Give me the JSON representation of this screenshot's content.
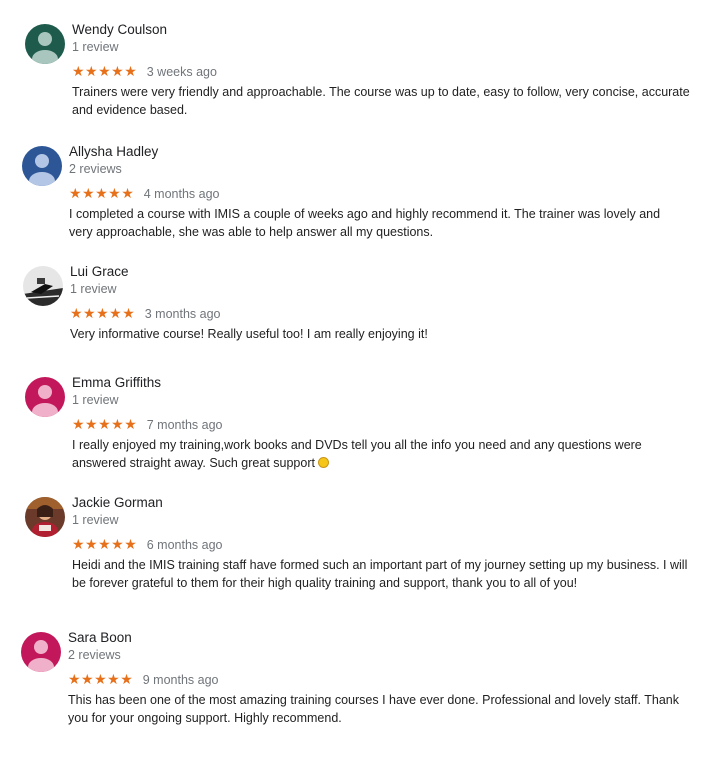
{
  "reviews": [
    {
      "name": "Wendy Coulson",
      "count": "1 review",
      "stars": "★★★★★",
      "time": "3 weeks ago",
      "text": "Trainers were very friendly and approachable.  The course was up to date, easy to follow, very concise, accurate and evidence based.",
      "avatar_color": "#1e5b4c"
    },
    {
      "name": "Allysha Hadley",
      "count": "2 reviews",
      "stars": "★★★★★",
      "time": "4 months ago",
      "text": "I completed a course with IMIS a couple of weeks ago and highly recommend it. The trainer was lovely and very approachable, she was able to help answer all my questions.",
      "avatar_color": "#2c5696"
    },
    {
      "name": "Lui Grace",
      "count": "1 review",
      "stars": "★★★★★",
      "time": "3 months ago",
      "text": "Very informative course! Really useful too! I am really enjoying it!",
      "avatar_color": "#2b2b2b"
    },
    {
      "name": "Emma Griffiths",
      "count": "1 review",
      "stars": "★★★★★",
      "time": "7 months ago",
      "text": "I really enjoyed my training,work books and DVDs tell you all the info you need and any questions were answered straight away. Such great support",
      "avatar_color": "#c2185b"
    },
    {
      "name": "Jackie Gorman",
      "count": "1 review",
      "stars": "★★★★★",
      "time": "6 months ago",
      "text": "Heidi and the IMIS training staff have formed such an important part of my journey setting up my business. I will be forever grateful to them for their high quality training and support, thank you to all of you!",
      "avatar_color": "#6b3a2a"
    },
    {
      "name": "Sara Boon",
      "count": "2 reviews",
      "stars": "★★★★★",
      "time": "9 months ago",
      "text": "This has been one of the most amazing training courses I have ever done. Professional and lovely staff. Thank you for your ongoing support. Highly recommend.",
      "avatar_color": "#c2185b"
    }
  ]
}
